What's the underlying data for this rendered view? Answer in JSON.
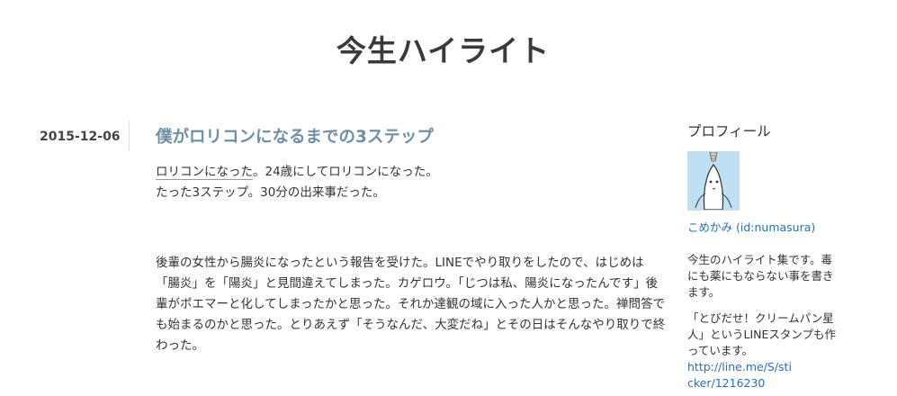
{
  "blog": {
    "title": "今生ハイライト"
  },
  "entry": {
    "date": "2015-12-06",
    "title": "僕がロリコンになるまでの3ステップ",
    "lead_link": "ロリコンになった",
    "lead_rest": "。24歳にしてロリコンになった。",
    "line2": "たった3ステップ。30分の出来事だった。",
    "paragraph2": "後輩の女性から腸炎になったという報告を受けた。LINEでやり取りをしたので、はじめは「腸炎」を「陽炎」と見間違えてしまった。カゲロウ。「じつは私、陽炎になったんです」後輩がポエマーと化してしまったかと思った。それか達観の域に入った人かと思った。禅問答でも始まるのかと思った。とりあえず「そうなんだ、大変だね」とその日はそんなやり取りで終わった。"
  },
  "sidebar": {
    "heading": "プロフィール",
    "avatar_icon": "avatar-illustration",
    "profile_name": "こめかみ (id:numasura)",
    "description": "今生のハイライト集です。毒にも薬にもならない事を書きます。",
    "stamp_text": "「とびだせ！クリームパン星人」というLINEスタンプも作っています。",
    "stamp_link": "http://line.me/S/sticker/1216230"
  },
  "colors": {
    "title_link": "#6f8ea8",
    "link": "#2a6fb5",
    "text": "#333333"
  }
}
